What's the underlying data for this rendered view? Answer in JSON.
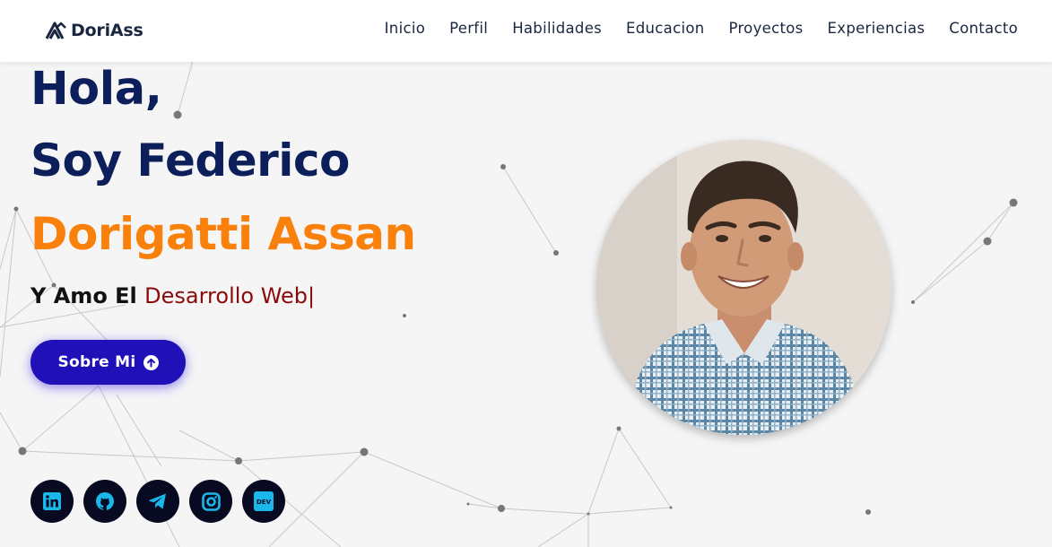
{
  "brand": {
    "name": "DoriAss",
    "logo_icon": "triangle-a-logo-icon"
  },
  "nav": {
    "items": [
      {
        "label": "Inicio"
      },
      {
        "label": "Perfil"
      },
      {
        "label": "Habilidades"
      },
      {
        "label": "Educacion"
      },
      {
        "label": "Proyectos"
      },
      {
        "label": "Experiencias"
      },
      {
        "label": "Contacto"
      }
    ]
  },
  "hero": {
    "greeting": "Hola,",
    "intro": "Soy Federico",
    "surname": "Dorigatti Assan",
    "tagline_prefix": "Y Amo El ",
    "tagline_typed": "Desarrollo Web|",
    "cta_label": "Sobre Mi",
    "cta_icon": "arrow-up-circle-icon"
  },
  "socials": [
    {
      "name": "linkedin",
      "icon": "linkedin-icon"
    },
    {
      "name": "github",
      "icon": "github-icon"
    },
    {
      "name": "telegram",
      "icon": "telegram-icon"
    },
    {
      "name": "instagram",
      "icon": "instagram-icon"
    },
    {
      "name": "dev",
      "icon": "dev-icon",
      "label": "DEV"
    }
  ],
  "colors": {
    "navy": "#0c1f5a",
    "orange": "#f9800b",
    "dark_red": "#8a0b0b",
    "cta_blue": "#2010b8",
    "social_bg": "#080a22",
    "social_icon": "#1ab7ea"
  }
}
